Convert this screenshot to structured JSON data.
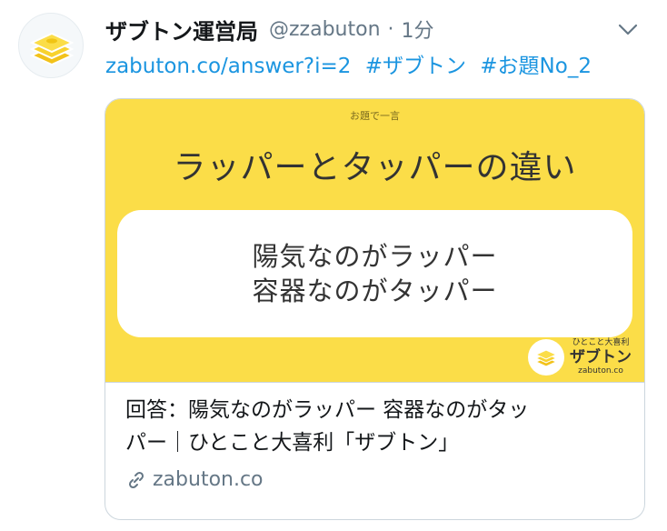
{
  "colors": {
    "accent": "#1b95e0",
    "card_image_bg": "#fbdd48",
    "secondary_text": "#657786"
  },
  "tweet": {
    "author_name": "ザブトン運営局",
    "handle": "@zzabuton",
    "separator": "·",
    "time": "1分",
    "link_text": "zabuton.co/answer?i=2",
    "hashtags": [
      "#ザブトン",
      "#お題No_2"
    ]
  },
  "card": {
    "image": {
      "topic_label": "お題で一言",
      "topic_title": "ラッパーとタッパーの違い",
      "answer_lines": [
        "陽気なのがラッパー",
        "容器なのがタッパー"
      ],
      "brand_tagline": "ひとこと大喜利",
      "brand_name": "ザブトン",
      "brand_domain": "zabuton.co"
    },
    "title_lines": [
      "回答：陽気なのがラッパー 容器なのがタッ",
      "パー｜ひとこと大喜利「ザブトン」"
    ],
    "domain": "zabuton.co"
  },
  "icons": {
    "avatar": "cushion-stack-icon",
    "menu": "chevron-down-icon",
    "link": "link-icon"
  }
}
